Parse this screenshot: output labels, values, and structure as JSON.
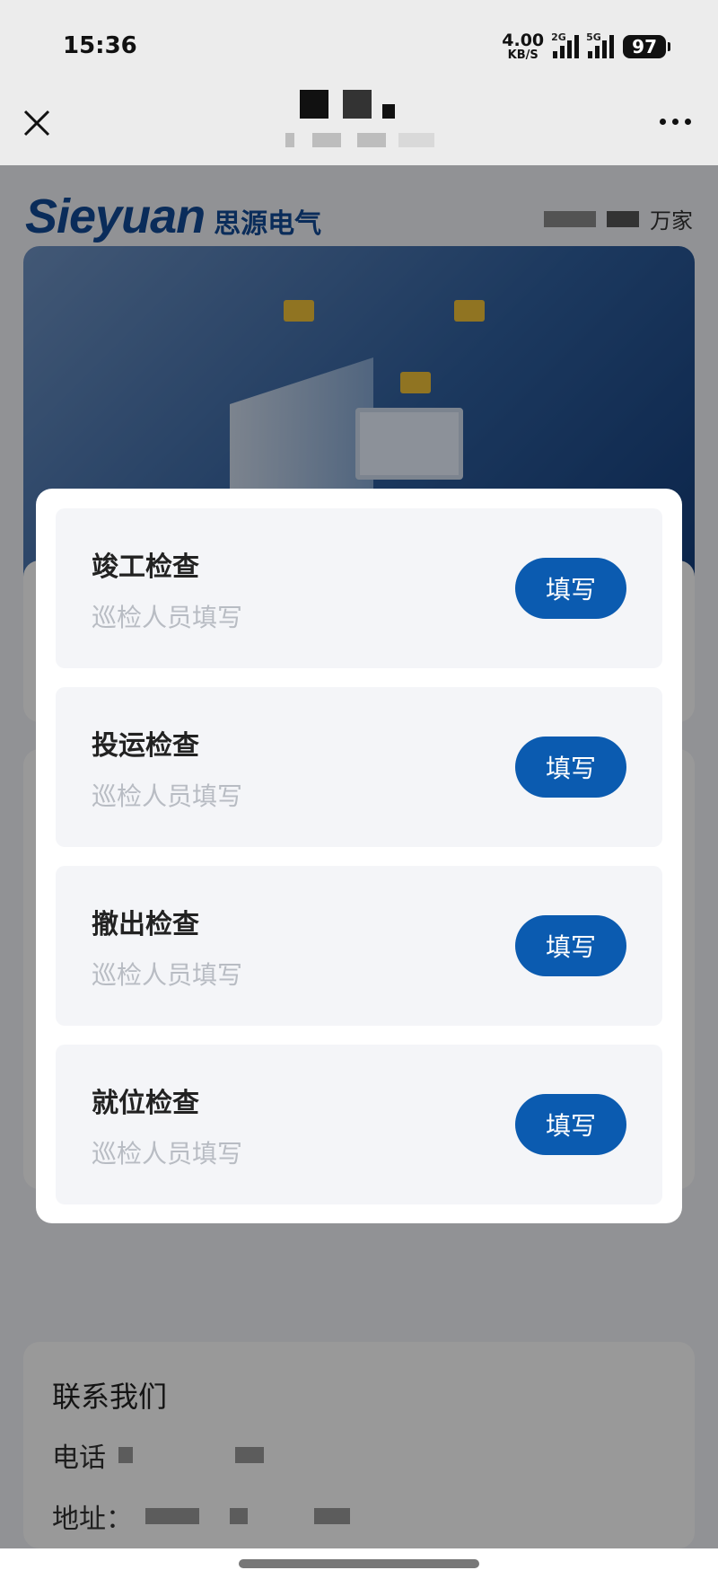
{
  "status_bar": {
    "time": "15:36",
    "net_speed": "4.00",
    "net_unit": "KB/S",
    "sim1_label": "2G",
    "sim2_label": "5G",
    "battery": "97"
  },
  "nav": {
    "close_icon": "close-icon",
    "more_icon": "more-dots-icon"
  },
  "header": {
    "logo_en": "Sieyuan",
    "logo_cn": "思源电气",
    "right_text": "万家"
  },
  "dialog": {
    "items": [
      {
        "title": "竣工检查",
        "subtitle": "巡检人员填写",
        "button": "填写"
      },
      {
        "title": "投运检查",
        "subtitle": "巡检人员填写",
        "button": "填写"
      },
      {
        "title": "撤出检查",
        "subtitle": "巡检人员填写",
        "button": "填写"
      },
      {
        "title": "就位检查",
        "subtitle": "巡检人员填写",
        "button": "填写"
      }
    ]
  },
  "contact": {
    "title": "联系我们",
    "phone_label": "电话",
    "address_label": "地址："
  },
  "colors": {
    "primary_button": "#0b5bb0",
    "brand_blue": "#124a96"
  }
}
